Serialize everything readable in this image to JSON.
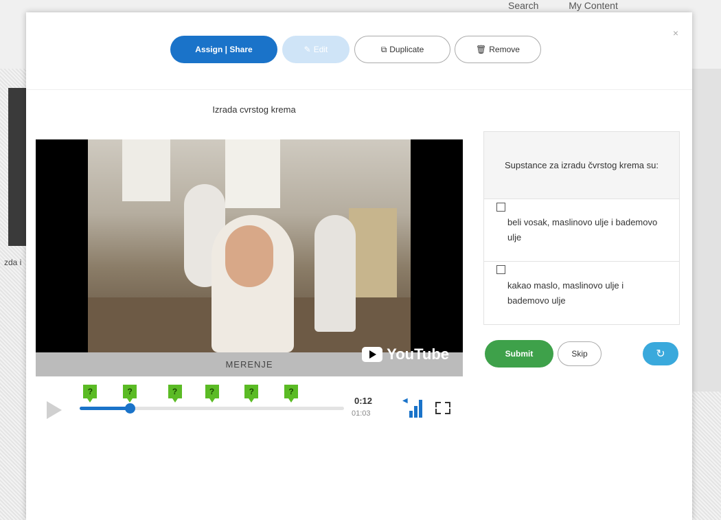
{
  "background": {
    "links": [
      "Search",
      "My Content"
    ],
    "side_text": "zda i"
  },
  "modal": {
    "close_icon": "×",
    "toolbar": {
      "assign_label": "Assign | Share",
      "edit_label": "Edit",
      "edit_icon": "pencil-icon",
      "duplicate_label": "Duplicate",
      "duplicate_icon": "copy-icon",
      "remove_label": "Remove",
      "remove_icon": "trash-icon"
    },
    "video": {
      "title": "Izrada cvrstog krema",
      "caption": "MERENJE",
      "brand": "YouTube",
      "current_time": "0:12",
      "total_time": "01:03",
      "progress_fraction": 0.19,
      "question_marker_label": "?",
      "question_marker_fractions": [
        0.04,
        0.19,
        0.36,
        0.5,
        0.65,
        0.8
      ]
    },
    "question": {
      "prompt": "Supstance za izradu čvrstog krema su:",
      "options": [
        "beli vosak, maslinovo ulje i bademovo ulje",
        "kakao maslo, maslinovo ulje i bademovo ulje"
      ],
      "submit_label": "Submit",
      "skip_label": "Skip",
      "retry_icon": "↻"
    }
  },
  "colors": {
    "primary": "#1a73c9",
    "submit": "#3ea14a",
    "marker": "#5bbb25",
    "retry": "#3aa9dc"
  }
}
